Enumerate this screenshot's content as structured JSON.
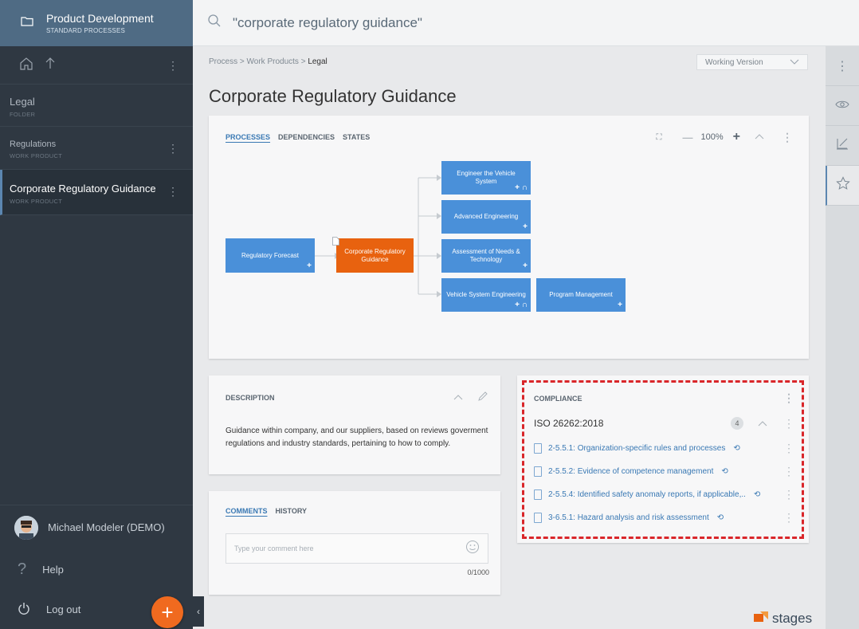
{
  "sidebar": {
    "workspace_title": "Product Development",
    "workspace_subtitle": "STANDARD PROCESSES",
    "items": [
      {
        "label": "Legal",
        "type": "FOLDER"
      },
      {
        "label": "Regulations",
        "type": "WORK PRODUCT"
      },
      {
        "label": "Corporate Regulatory Guidance",
        "type": "WORK PRODUCT"
      }
    ],
    "user_name": "Michael Modeler (DEMO)",
    "help_label": "Help",
    "logout_label": "Log out"
  },
  "search": {
    "query": "\"corporate regulatory guidance\""
  },
  "breadcrumb": {
    "path": "Process > Work Products > ",
    "current": "Legal"
  },
  "version_select": {
    "value": "Working Version"
  },
  "page_title": "Corporate Regulatory Guidance",
  "diagram_card": {
    "tabs": [
      "PROCESSES",
      "DEPENDENCIES",
      "STATES"
    ],
    "zoom": "100%",
    "nodes": {
      "regulatory_forecast": "Regulatory Forecast",
      "corporate_guidance": "Corporate Regulatory Guidance",
      "engineer_vehicle": "Engineer the Vehicle System",
      "advanced_engineering": "Advanced Engineering",
      "assessment": "Assessment of Needs & Technology",
      "vehicle_system_eng": "Vehicle System Engineering",
      "program_management": "Program Management"
    }
  },
  "description": {
    "heading": "DESCRIPTION",
    "text": "Guidance within company, and our suppliers, based on reviews goverment regulations and industry standards, pertaining to how to comply."
  },
  "comments": {
    "tabs": [
      "COMMENTS",
      "HISTORY"
    ],
    "placeholder": "Type your comment here",
    "counter": "0/1000"
  },
  "compliance": {
    "heading": "COMPLIANCE",
    "standard": "ISO 26262:2018",
    "count": "4",
    "items": [
      "2-5.5.1: Organization-specific rules and processes",
      "2-5.5.2: Evidence of competence management",
      "2-5.5.4: Identified safety anomaly reports, if applicable,..",
      "3-6.5.1: Hazard analysis and risk assessment"
    ]
  },
  "brand": {
    "name": "stages"
  },
  "colors": {
    "accent": "#3a79b4",
    "orange": "#e8620f",
    "node_blue": "#4a90d9",
    "highlight": "#d9262a"
  }
}
